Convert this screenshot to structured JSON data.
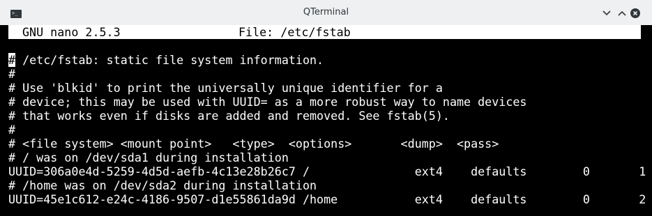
{
  "window": {
    "title": "QTerminal",
    "icon": "terminal-icon",
    "controls": {
      "minimize_icon": "chevron-down-icon",
      "maximize_icon": "chevron-up-icon",
      "close_icon": "close-icon"
    }
  },
  "colors": {
    "titlebar_bg": "#eff0f1",
    "titlebar_text": "#31363b",
    "terminal_bg": "#000000",
    "terminal_fg": "#ffffff",
    "header_bg": "#ffffff",
    "header_fg": "#000000"
  },
  "nano": {
    "version": "GNU nano 2.5.3",
    "file": "File: /etc/fstab"
  },
  "editor": {
    "cursor_char": "#",
    "lines": [
      " /etc/fstab: static file system information.",
      "#",
      "# Use 'blkid' to print the universally unique identifier for a",
      "# device; this may be used with UUID= as a more robust way to name devices",
      "# that works even if disks are added and removed. See fstab(5).",
      "#",
      "# <file system> <mount point>   <type>  <options>       <dump>  <pass>",
      "# / was on /dev/sda1 during installation",
      "UUID=306a0e4d-5259-4d5d-aefb-4c13e28b26c7 /               ext4    defaults        0       1",
      "# /home was on /dev/sda2 during installation",
      "UUID=45e1c612-e24c-4186-9507-d1e55861da9d /home           ext4    defaults        0       2"
    ]
  }
}
